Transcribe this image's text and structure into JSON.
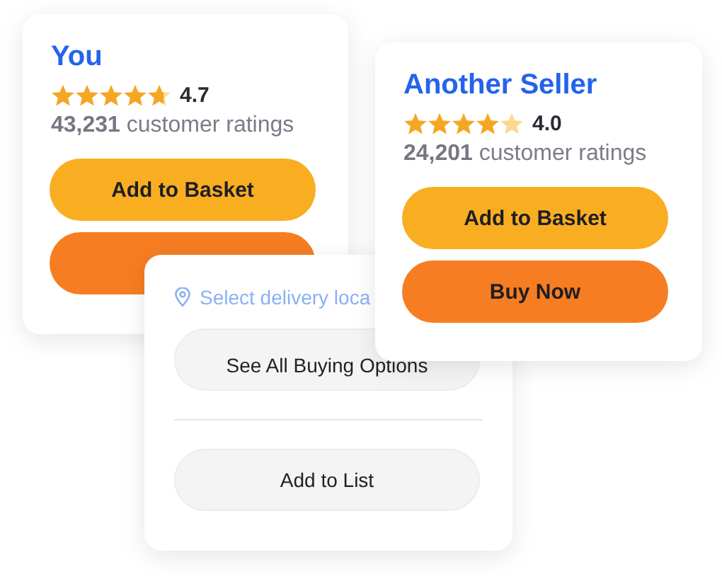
{
  "sellers": [
    {
      "name": "You",
      "stars": 4.7,
      "rating": "4.7",
      "count": "43,231",
      "count_label": "customer ratings",
      "buttons": [
        {
          "kind": "basket",
          "label": "Add to Basket"
        },
        {
          "kind": "buy"
        }
      ]
    },
    {
      "name": "Another Seller",
      "stars": 4,
      "rating": "4.0",
      "count": "24,201",
      "count_label": "customer ratings",
      "buttons": [
        {
          "kind": "basket",
          "label": "Add to Basket"
        },
        {
          "kind": "buy",
          "label": "Buy Now"
        }
      ]
    }
  ],
  "options": {
    "delivery": "Select delivery loca",
    "buttons": [
      "See All Buying Options",
      "Add to List"
    ]
  }
}
